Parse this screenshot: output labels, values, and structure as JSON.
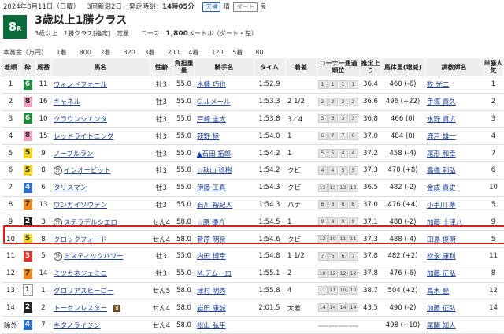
{
  "header": {
    "date": "2024年8月11日（日曜）",
    "meeting": "3回新潟2日",
    "start_label": "発走時刻：",
    "start_time": "14時05分",
    "weather_label": "天候",
    "weather": "晴",
    "track_label": "ダート",
    "condition": "良"
  },
  "race": {
    "number": "8",
    "number_suffix": "R",
    "name": "3歳以上1勝クラス",
    "class_info": "3歳以上　1勝クラス[指定]　定量",
    "course_label": "コース：",
    "distance": "1,800",
    "course_detail": "メートル（ダート・左）"
  },
  "prize": {
    "label": "本賞金（万円）",
    "items": [
      "1着　　800",
      "2着　　320",
      "3着　　200",
      "4着　　120",
      "5着　　80"
    ]
  },
  "columns": [
    "着順",
    "枠",
    "馬番",
    "馬名",
    "性齢",
    "負担重量",
    "騎手名",
    "タイム",
    "着差",
    "コーナー通過順位",
    "推定上り",
    "馬体重(増減)",
    "調教師名",
    "単勝人気"
  ],
  "rows": [
    {
      "rank": "1",
      "waku": "6",
      "num": "11",
      "horse": "ウィンドフォール",
      "mark": "",
      "blink": "",
      "sexage": "牡3",
      "weight": "55.0",
      "jockey": "木幡 巧也",
      "time": "1:52.9",
      "margin": "",
      "corner": [
        "1",
        "1",
        "1",
        "1"
      ],
      "last3f": "36.4",
      "body": "460 (-6)",
      "trainer": "牧 光二",
      "pop": "1"
    },
    {
      "rank": "2",
      "waku": "8",
      "num": "16",
      "horse": "キャネル",
      "mark": "",
      "blink": "",
      "sexage": "牡3",
      "weight": "55.0",
      "jockey": "C.ルメール",
      "time": "1:53.3",
      "margin": "2 1/2",
      "corner": [
        "2",
        "2",
        "2",
        "2"
      ],
      "last3f": "36.6",
      "body": "496 (+22)",
      "trainer": "手塚 貴久",
      "pop": "2"
    },
    {
      "rank": "3",
      "waku": "6",
      "num": "10",
      "horse": "クラウンシエンタ",
      "mark": "",
      "blink": "",
      "sexage": "牡3",
      "weight": "55.0",
      "jockey": "戸崎 圭太",
      "time": "1:53.8",
      "margin": "3／4",
      "corner": [
        "3",
        "3",
        "3",
        "3"
      ],
      "last3f": "36.8",
      "body": "466 (0)",
      "trainer": "水野 貴広",
      "pop": "3"
    },
    {
      "rank": "4",
      "waku": "8",
      "num": "15",
      "horse": "レッドライトニング",
      "mark": "",
      "blink": "",
      "sexage": "牡3",
      "weight": "55.0",
      "jockey": "荻野 極",
      "time": "1:54.0",
      "margin": "1",
      "corner": [
        "6",
        "7",
        "7",
        "6"
      ],
      "last3f": "37.0",
      "body": "484 (0)",
      "trainer": "鹿戸 雄一",
      "pop": "4"
    },
    {
      "rank": "5",
      "waku": "5",
      "num": "9",
      "horse": "ノーブルラン",
      "mark": "",
      "blink": "",
      "sexage": "牡3",
      "weight": "55.0",
      "jockey": "▲石田 拓郎",
      "time": "1:54.2",
      "margin": "1",
      "corner": [
        "5",
        "5",
        "4",
        "4"
      ],
      "last3f": "37.2",
      "body": "458 (-4)",
      "trainer": "尾形 和幸",
      "pop": "7"
    },
    {
      "rank": "6",
      "waku": "5",
      "num": "8",
      "horse": "インオービット",
      "mark": "外",
      "blink": "",
      "sexage": "牡3",
      "weight": "55.0",
      "jockey": "☆秋山 稔樹",
      "time": "1:54.2",
      "margin": "クビ",
      "corner": [
        "4",
        "4",
        "5",
        "5"
      ],
      "last3f": "37.3",
      "body": "470 (+8)",
      "trainer": "高橋 利弘",
      "pop": "6"
    },
    {
      "rank": "7",
      "waku": "4",
      "num": "6",
      "horse": "タリスマン",
      "mark": "",
      "blink": "",
      "sexage": "牡3",
      "weight": "55.0",
      "jockey": "伊藤 工真",
      "time": "1:54.3",
      "margin": "クビ",
      "corner": [
        "13",
        "13",
        "13",
        "13"
      ],
      "last3f": "36.5",
      "body": "482 (-2)",
      "trainer": "金成 貴史",
      "pop": "10"
    },
    {
      "rank": "8",
      "waku": "7",
      "num": "13",
      "horse": "ウンガイソウテン",
      "mark": "",
      "blink": "",
      "sexage": "牡3",
      "weight": "55.0",
      "jockey": "石川 裕紀人",
      "time": "1:54.3",
      "margin": "ハナ",
      "corner": [
        "8",
        "8",
        "8",
        "8"
      ],
      "last3f": "37.0",
      "body": "476 (+4)",
      "trainer": "小手川 準",
      "pop": "5"
    },
    {
      "rank": "9",
      "waku": "2",
      "num": "3",
      "horse": "ステラデルシエロ",
      "mark": "外",
      "blink": "",
      "sexage": "せん4",
      "weight": "58.0",
      "jockey": "☆原 優介",
      "time": "1:54.5",
      "margin": "1",
      "corner": [
        "9",
        "9",
        "9",
        "9"
      ],
      "last3f": "37.1",
      "body": "488 (-2)",
      "trainer": "加藤 士津八",
      "pop": "9"
    },
    {
      "rank": "10",
      "waku": "5",
      "num": "8",
      "horse": "クロックフォード",
      "mark": "",
      "blink": "",
      "sexage": "せん4",
      "weight": "58.0",
      "jockey": "菅原 明良",
      "time": "1:54.6",
      "margin": "クビ",
      "corner": [
        "12",
        "10",
        "11",
        "11"
      ],
      "last3f": "37.3",
      "body": "488 (-4)",
      "trainer": "田島 俊明",
      "pop": "5"
    },
    {
      "rank": "11",
      "waku": "3",
      "num": "5",
      "horse": "ミスティックパワー",
      "mark": "外",
      "blink": "",
      "sexage": "牡3",
      "weight": "55.0",
      "jockey": "内田 博幸",
      "time": "1:54.8",
      "margin": "1 1/2",
      "corner": [
        "7",
        "6",
        "6",
        "7"
      ],
      "last3f": "37.8",
      "body": "482 (+2)",
      "trainer": "松永 康利",
      "pop": "11"
    },
    {
      "rank": "12",
      "waku": "7",
      "num": "14",
      "horse": "ミツカネジェミニ",
      "mark": "",
      "blink": "",
      "sexage": "牡3",
      "weight": "55.0",
      "jockey": "M.デムーロ",
      "time": "1:55.1",
      "margin": "2",
      "corner": [
        "10",
        "12",
        "12",
        "12"
      ],
      "last3f": "37.8",
      "body": "476 (-6)",
      "trainer": "加藤 征弘",
      "pop": "8"
    },
    {
      "rank": "13",
      "waku": "1",
      "num": "1",
      "horse": "グロリアスヒーロー",
      "mark": "",
      "blink": "",
      "sexage": "せん5",
      "weight": "58.0",
      "jockey": "津村 明秀",
      "time": "1:55.8",
      "margin": "4",
      "corner": [
        "11",
        "11",
        "10",
        "10"
      ],
      "last3f": "38.7",
      "body": "504 (+2)",
      "trainer": "髙木 登",
      "pop": "12"
    },
    {
      "rank": "14",
      "waku": "2",
      "num": "2",
      "horse": "トーセンレスター",
      "mark": "",
      "blink": "B",
      "sexage": "せん4",
      "weight": "58.0",
      "jockey": "岩田 康誠",
      "time": "2:01.5",
      "margin": "大差",
      "corner": [
        "14",
        "14",
        "14",
        "14"
      ],
      "last3f": "43.5",
      "body": "490 (-2)",
      "trainer": "加藤 征弘",
      "pop": "14"
    },
    {
      "rank": "除外",
      "waku": "4",
      "num": "7",
      "horse": "キタノライジン",
      "mark": "",
      "blink": "",
      "sexage": "せん4",
      "weight": "58.0",
      "jockey": "松山 弘平",
      "time": "",
      "margin": "",
      "corner": [
        "",
        "",
        "",
        ""
      ],
      "last3f": "",
      "body": "498 (+10)",
      "trainer": "尾関 知人",
      "pop": ""
    }
  ],
  "waku_colors": {
    "1": "#ffffff",
    "2": "#222222",
    "3": "#e0302a",
    "4": "#2a6fd6",
    "5": "#f2d51c",
    "6": "#1d8a3c",
    "7": "#f08a1c",
    "8": "#f2a0c0"
  },
  "highlighted_row": "10"
}
